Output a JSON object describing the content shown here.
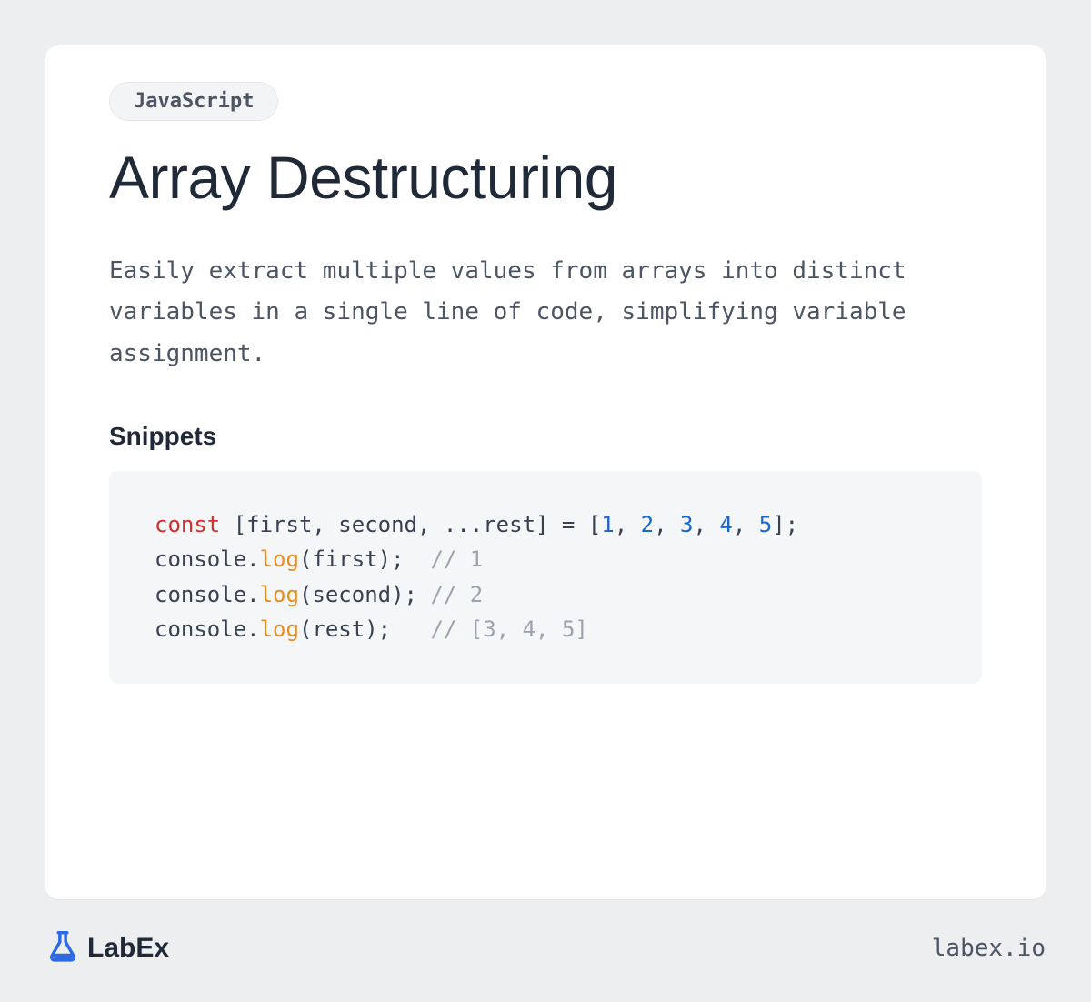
{
  "tag": "JavaScript",
  "title": "Array Destructuring",
  "description": "Easily extract multiple values from arrays into distinct variables in a single line of code, simplifying variable assignment.",
  "section_title": "Snippets",
  "code": {
    "line1_kw": "const",
    "line1_rest": " [first, second, ...rest] = [",
    "line1_n1": "1",
    "line1_c1": ", ",
    "line1_n2": "2",
    "line1_c2": ", ",
    "line1_n3": "3",
    "line1_c3": ", ",
    "line1_n4": "4",
    "line1_c4": ", ",
    "line1_n5": "5",
    "line1_end": "];",
    "line2_pre": "console.",
    "line2_fn": "log",
    "line2_post": "(first);  ",
    "line2_cm": "// 1",
    "line3_pre": "console.",
    "line3_fn": "log",
    "line3_post": "(second); ",
    "line3_cm": "// 2",
    "line4_pre": "console.",
    "line4_fn": "log",
    "line4_post": "(rest);   ",
    "line4_cm": "// [3, 4, 5]"
  },
  "footer": {
    "brand": "LabEx",
    "url": "labex.io"
  }
}
